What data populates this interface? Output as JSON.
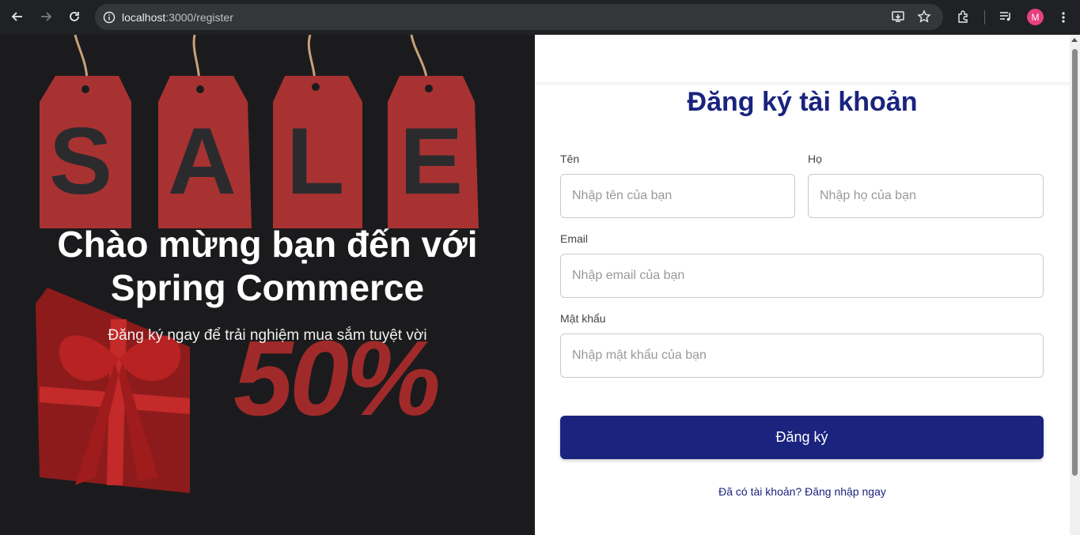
{
  "browser": {
    "url_host": "localhost",
    "url_path": ":3000/register",
    "profile_initial": "M",
    "profile_color": "#e8407f"
  },
  "hero": {
    "title_line1": "Chào mừng bạn đến với",
    "title_line2": "Spring Commerce",
    "subtitle": "Đăng ký ngay để trải nghiệm mua sắm tuyệt vời",
    "image_text_tags": [
      "S",
      "A",
      "L",
      "E"
    ],
    "image_text_discount": "50%"
  },
  "form": {
    "title": "Đăng ký tài khoản",
    "first_name_label": "Tên",
    "first_name_placeholder": "Nhập tên của bạn",
    "last_name_label": "Họ",
    "last_name_placeholder": "Nhập họ của bạn",
    "email_label": "Email",
    "email_placeholder": "Nhập email của bạn",
    "password_label": "Mật khẩu",
    "password_placeholder": "Nhập mật khẩu của bạn",
    "submit_label": "Đăng ký",
    "login_link": "Đã có tài khoản? Đăng nhập ngay"
  },
  "colors": {
    "accent": "#1a237e",
    "hero_bg": "#1b1b1d",
    "tag_red": "#a83232"
  }
}
